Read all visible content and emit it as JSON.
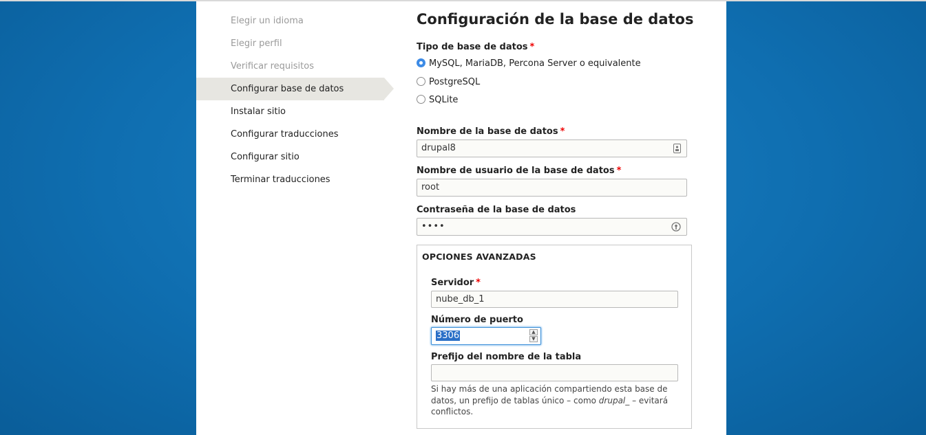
{
  "steps": [
    {
      "label": "Elegir un idioma",
      "state": "done"
    },
    {
      "label": "Elegir perfil",
      "state": "done"
    },
    {
      "label": "Verificar requisitos",
      "state": "done"
    },
    {
      "label": "Configurar base de datos",
      "state": "active"
    },
    {
      "label": "Instalar sitio",
      "state": "pending"
    },
    {
      "label": "Configurar traducciones",
      "state": "pending"
    },
    {
      "label": "Configurar sitio",
      "state": "pending"
    },
    {
      "label": "Terminar traducciones",
      "state": "pending"
    }
  ],
  "page_title": "Configuración de la base de datos",
  "required_mark": "*",
  "db_type": {
    "label": "Tipo de base de datos",
    "options": [
      "MySQL, MariaDB, Percona Server o equivalente",
      "PostgreSQL",
      "SQLite"
    ],
    "selected": "MySQL, MariaDB, Percona Server o equivalente"
  },
  "db_name": {
    "label": "Nombre de la base de datos",
    "value": "drupal8"
  },
  "db_user": {
    "label": "Nombre de usuario de la base de datos",
    "value": "root"
  },
  "db_pass": {
    "label": "Contraseña de la base de datos",
    "value": "••••"
  },
  "advanced": {
    "title": "OPCIONES AVANZADAS",
    "host": {
      "label": "Servidor",
      "value": "nube_db_1"
    },
    "port": {
      "label": "Número de puerto",
      "value": "3306"
    },
    "prefix": {
      "label": "Prefijo del nombre de la tabla",
      "value": "",
      "desc_before": "Si hay más de una aplicación compartiendo esta base de datos, un prefijo de tablas único – como ",
      "desc_em": "drupal_",
      "desc_after": " – evitará conflictos."
    }
  },
  "colors": {
    "accent": "#3d8be6",
    "required": "#ee0000",
    "background": "#1a7fc2",
    "active_step": "#e7e6e1"
  }
}
